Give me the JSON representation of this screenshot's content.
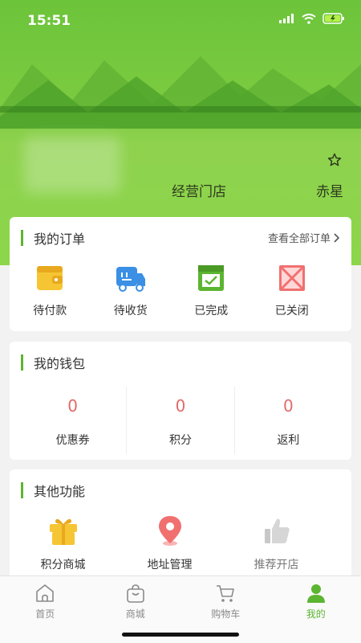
{
  "status": {
    "time": "15:51"
  },
  "header": {
    "store_name": "经营门店",
    "store_right": "赤星",
    "fav_icon": "star-outline-icon"
  },
  "orders": {
    "title": "我的订单",
    "view_all": "查看全部订单",
    "items": [
      {
        "label": "待付款",
        "icon": "wallet-icon"
      },
      {
        "label": "待收货",
        "icon": "truck-icon"
      },
      {
        "label": "已完成",
        "icon": "check-box-icon"
      },
      {
        "label": "已关闭",
        "icon": "closed-box-icon"
      }
    ]
  },
  "wallet": {
    "title": "我的钱包",
    "items": [
      {
        "value": "0",
        "label": "优惠券"
      },
      {
        "value": "0",
        "label": "积分"
      },
      {
        "value": "0",
        "label": "返利"
      }
    ]
  },
  "other": {
    "title": "其他功能",
    "items": [
      {
        "label": "积分商城",
        "icon": "gift-icon"
      },
      {
        "label": "地址管理",
        "icon": "location-pin-icon"
      },
      {
        "label": "推荐开店",
        "icon": "thumbs-up-icon"
      }
    ]
  },
  "tabbar": {
    "tabs": [
      {
        "label": "首页",
        "icon": "home-icon",
        "active": false
      },
      {
        "label": "商城",
        "icon": "bag-icon",
        "active": false
      },
      {
        "label": "购物车",
        "icon": "cart-icon",
        "active": false
      },
      {
        "label": "我的",
        "icon": "person-icon",
        "active": true
      }
    ]
  },
  "colors": {
    "accent": "#5cb531",
    "number": "#e36a6a"
  }
}
